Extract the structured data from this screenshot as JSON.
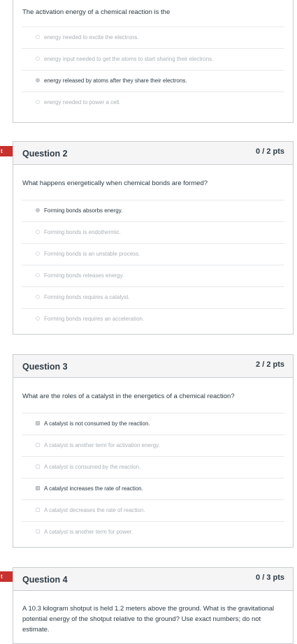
{
  "q1": {
    "text": "The activation energy of a chemical reaction is the",
    "options": [
      {
        "label": "energy needed to excite the electrons.",
        "selected": false
      },
      {
        "label": "energy input needed to get the atoms to start sharing their electrons.",
        "selected": false
      },
      {
        "label": "energy released by atoms after they share their electrons.",
        "selected": true
      },
      {
        "label": "energy needed to power a cell.",
        "selected": false
      }
    ]
  },
  "q2": {
    "flag": "t",
    "title": "Question 2",
    "points": "0 / 2 pts",
    "text": "What happens energetically when chemical bonds are formed?",
    "options": [
      {
        "label": "Forming bonds absorbs energy.",
        "selected": true
      },
      {
        "label": "Forming bonds is endothermic.",
        "selected": false
      },
      {
        "label": "Forming bonds is an unstable process.",
        "selected": false
      },
      {
        "label": "Forming bonds releases energy.",
        "selected": false
      },
      {
        "label": "Forming bonds requires a catalyst.",
        "selected": false
      },
      {
        "label": "Forming bonds requires an acceleration.",
        "selected": false
      }
    ]
  },
  "q3": {
    "title": "Question 3",
    "points": "2 / 2 pts",
    "text": "What are the roles of a catalyst in the energetics of a chemical reaction?",
    "options": [
      {
        "label": "A catalyst is not consumed by the reaction.",
        "selected": true
      },
      {
        "label": "A catalyst is another term for activation energy.",
        "selected": false
      },
      {
        "label": "A catalyst is consumed by the reaction.",
        "selected": false
      },
      {
        "label": "A catalyst increases the rate of reaction.",
        "selected": true
      },
      {
        "label": "A catalyst decreases the rate of reaction.",
        "selected": false
      },
      {
        "label": "A catalyst is another term for power.",
        "selected": false
      }
    ]
  },
  "q4": {
    "flag": "t",
    "title": "Question 4",
    "points": "0 / 3 pts",
    "text": "A 10.3 kilogram shotput is held 1.2 meters above the ground. What is the gravitational potential energy of the shotput relative to the ground? Use exact numbers; do not estimate."
  }
}
